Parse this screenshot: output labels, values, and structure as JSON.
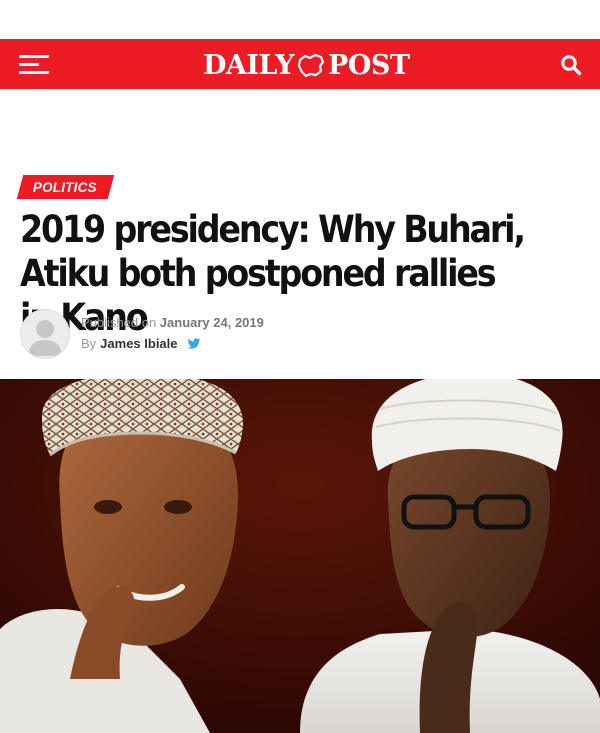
{
  "header": {
    "logo_left": "DAILY",
    "logo_right": "POST",
    "menu_icon": "hamburger-menu-icon",
    "search_icon": "search-icon",
    "brand_color": "#ed1c24"
  },
  "article": {
    "category": "POLITICS",
    "title": "2019 presidency: Why Buhari, Atiku both postponed rallies in Kano",
    "published_label": "Published on",
    "published_date": "January 24, 2019",
    "by_label": "By",
    "author": "James Ibiale",
    "author_social_icon": "twitter-icon",
    "featured_image": "atiku-buhari-photo"
  }
}
